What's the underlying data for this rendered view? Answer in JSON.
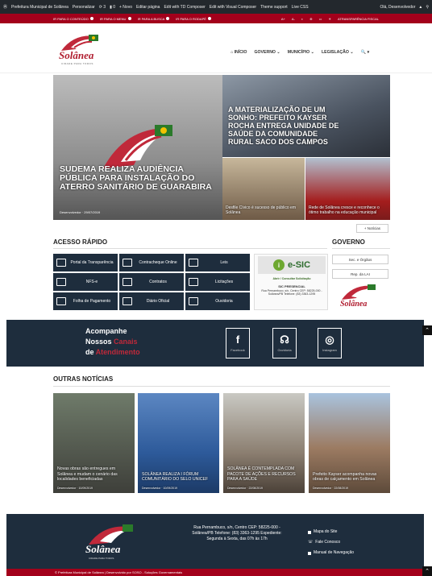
{
  "adminbar": {
    "site": "Prefeitura Municipal de Solânea",
    "customize": "Personalizar",
    "updates": "3",
    "comments": "0",
    "new": "+ Novo",
    "edit": "Editar página",
    "td": "Edit with TD Composer",
    "vc": "Edit with Visual Composer",
    "theme": "Theme support",
    "css": "Live CSS",
    "user": "Olá, Desenvolvedor"
  },
  "access": {
    "links": [
      "IR PARA O CONTEÚDO",
      "IR PARA O MENU",
      "IR PARA A BUSCA",
      "IR PARA O RODAPÉ"
    ],
    "right": [
      "A+",
      "A-",
      "◐",
      "⊕",
      "▭",
      "☀",
      "ATRANSPARÊNCIA FISCAL"
    ]
  },
  "brand": {
    "name": "Solânea",
    "tagline": "CIDADE PARA TODOS"
  },
  "nav": [
    {
      "label": "INÍCIO"
    },
    {
      "label": "GOVERNO ⌄"
    },
    {
      "label": "MUNICÍPIO ⌄"
    },
    {
      "label": "LEGISLAÇÃO ⌄"
    },
    {
      "label": "🔍 ▾"
    }
  ],
  "featured": {
    "main": {
      "title": "SUDEMA REALIZA AUDIÊNCIA PÚBLICA PARA INSTALAÇÃO DO ATERRO SANITÁRIO DE GUARABIRA",
      "author": "Desenvolvedor",
      "date": "29/07/2019"
    },
    "second": {
      "title": "A MATERIALIZAÇÃO DE UM SONHO: PREFEITO KAYSER ROCHA ENTREGA UNIDADE DE SAÚDE DA COMUNIDADE RURAL SACO DOS CAMPOS"
    },
    "third": {
      "title": "Desfile Cívico é sucesso de público em Solânea"
    },
    "fourth": {
      "title": "Rede de Solânea cresce e reconhece o ótimo trabalho na educação municipal"
    },
    "more": "+ Notícias"
  },
  "quick": {
    "title": "ACESSO RÁPIDO",
    "items": [
      {
        "label": "Portal da Transparência"
      },
      {
        "label": "Contracheque Online"
      },
      {
        "label": "Leis"
      },
      {
        "label": "NFS-e"
      },
      {
        "label": "Contratos"
      },
      {
        "label": "Licitações"
      },
      {
        "label": "Folha de Pagamento"
      },
      {
        "label": "Diário Oficial"
      },
      {
        "label": "Ouvidoria"
      }
    ],
    "esic": {
      "logo": "e-SIC",
      "access": "Abrir / Consultar Solicitação",
      "presential_title": "SIC PRESENCIAL",
      "presential_text": "Rua Pernambuco, s/n, Centro CEP: 58225-000 - Solânea/PB Telefone: (83) 3363-1295"
    }
  },
  "governo": {
    "title": "GOVERNO",
    "buttons": [
      "Sec. e Órgãos",
      "Rep. da LAI"
    ]
  },
  "social": {
    "line1": "Acompanhe",
    "line2a": "Nossos ",
    "line2b": "Canais",
    "line3a": "de ",
    "line3b": "Atendimento",
    "items": [
      {
        "glyph": "f",
        "label": "Facebook"
      },
      {
        "glyph": "☊",
        "label": "Ouvidoria"
      },
      {
        "glyph": "◎",
        "label": "Instagram"
      }
    ]
  },
  "others": {
    "title": "OUTRAS NOTÍCIAS",
    "items": [
      {
        "title": "Novas obras são entregues em Solânea e mudam o cenário das localidades beneficiadas",
        "author": "Desenvolvedor",
        "date": "10/09/2019"
      },
      {
        "title": "SOLÂNEA REALIZA I FÓRUM COMUNITÁRIO DO SELO UNICEF",
        "author": "Desenvolvedor",
        "date": "10/09/2019"
      },
      {
        "title": "SOLÂNEA É CONTEMPLADA COM PACOTE DE AÇÕES E RECURSOS PARA A SAÚDE",
        "author": "Desenvolvedor",
        "date": "22/08/2019"
      },
      {
        "title": "Prefeito Kayser acompanha novas obras de calçamento em Solânea",
        "author": "Desenvolvedor",
        "date": "22/08/2019"
      }
    ]
  },
  "footer": {
    "address": "Rua Pernambuco, s/n, Centro CEP: 58225-000 - Solânea/PB Telefone: (83) 3363-1295 Expediente: Segunda à Sexta, das 07h às 17h",
    "links": [
      "Mapa do Site",
      "Fale Conosco",
      "Manual de Navegação"
    ],
    "copyright": "© Prefeitura Municipal de Solânea | Desenvolvido por SOSO - Soluções Governamentais"
  }
}
